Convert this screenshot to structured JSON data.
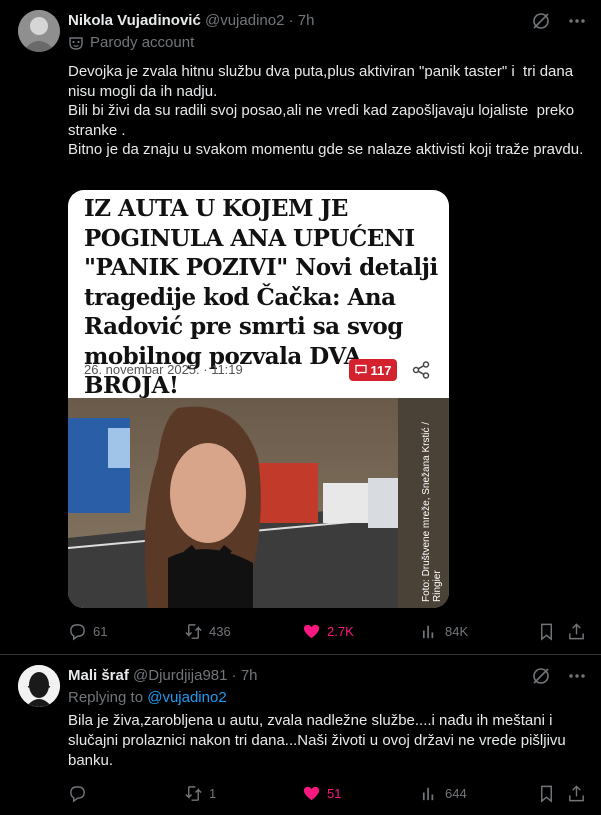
{
  "tweet1": {
    "author_name": "Nikola Vujadinović",
    "handle": "@vujadino2",
    "separator": "·",
    "time": "7h",
    "parody_label": "Parody account",
    "text": "Devojka je zvala hitnu službu dva puta,plus aktiviran \"panik taster\" i  tri dana nisu mogli da ih nadju.\nBili bi živi da su radili svoj posao,ali ne vredi kad zapošljavaju lojaliste  preko stranke .\nBitno je da znaju u svakom momentu gde se nalaze aktivisti koji traže pravdu.",
    "media": {
      "headline": "IZ AUTA U KOJEM JE POGINULA ANA UPUĆENI \"PANIK POZIVI\" Novi detalji tragedije kod Čačka: Ana Radović pre smrti sa svog mobilnog pozvala DVA BROJA!",
      "date": "26. novembar 2025. · 11:19",
      "comments_count": "117",
      "photo_credit": "Foto: Društvene mreže, Snežana Krstić / Ringier"
    },
    "stats": {
      "replies": "61",
      "reposts": "436",
      "likes": "2.7K",
      "views": "84K"
    }
  },
  "tweet2": {
    "author_name": "Mali šraf",
    "handle": "@Djurdjija981",
    "separator": "·",
    "time": "7h",
    "replying_label": "Replying to",
    "replying_handle": "@vujadino2",
    "text": "Bila je živa,zarobljena u autu, zvala nadležne službe....i nađu ih meštani i slučajni prolaznici nakon tri dana...Naši životi u ovoj državi ne vrede pišljivu banku.",
    "stats": {
      "replies": "",
      "reposts": "1",
      "likes": "51",
      "views": "644"
    }
  },
  "colors": {
    "background": "#000000",
    "text": "#e7e9ea",
    "muted": "#71767b",
    "like": "#f91880",
    "link": "#1d9bf0",
    "badge": "#d4212e"
  }
}
